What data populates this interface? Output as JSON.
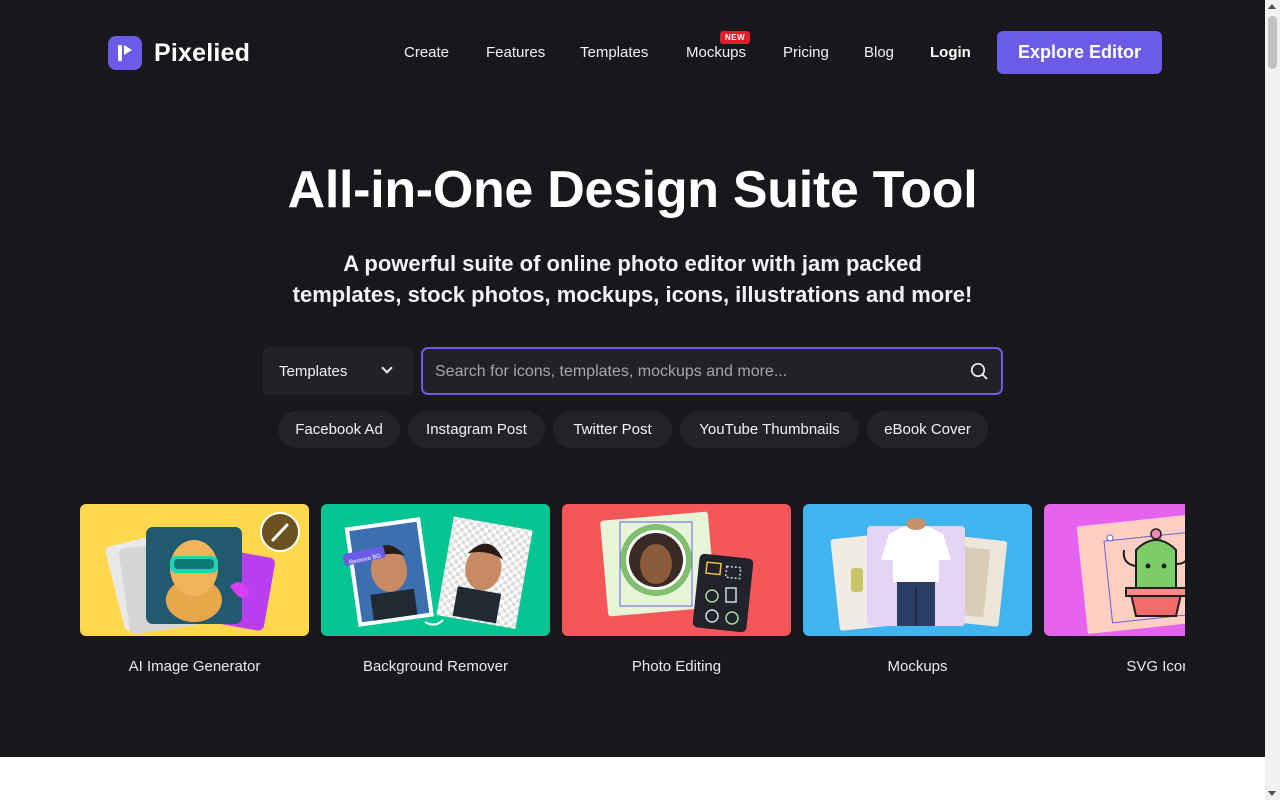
{
  "brand": {
    "name": "Pixelied",
    "accent": "#6b5ce7"
  },
  "nav": {
    "items": [
      "Create",
      "Features",
      "Templates",
      "Mockups",
      "Pricing",
      "Blog"
    ],
    "new_badge": "NEW",
    "login": "Login",
    "cta": "Explore Editor"
  },
  "hero": {
    "title": "All-in-One Design Suite Tool",
    "subtitle_line1": "A powerful suite of online photo editor with jam packed",
    "subtitle_line2": "templates, stock photos, mockups, icons, illustrations and more!"
  },
  "search": {
    "category": "Templates",
    "placeholder": "Search for icons, templates, mockups and more...",
    "icon": "search-icon"
  },
  "chips": [
    "Facebook Ad",
    "Instagram Post",
    "Twitter Post",
    "YouTube Thumbnails",
    "eBook Cover"
  ],
  "tools": [
    {
      "label": "AI Image Generator",
      "color": "#ffd84d"
    },
    {
      "label": "Background Remover",
      "color": "#06c593"
    },
    {
      "label": "Photo Editing",
      "color": "#f5565a"
    },
    {
      "label": "Mockups",
      "color": "#3fb4ef"
    },
    {
      "label": "SVG Icon",
      "color": "#e663f0"
    }
  ],
  "thumb_badges": {
    "remove_bg": "Remove BG"
  }
}
